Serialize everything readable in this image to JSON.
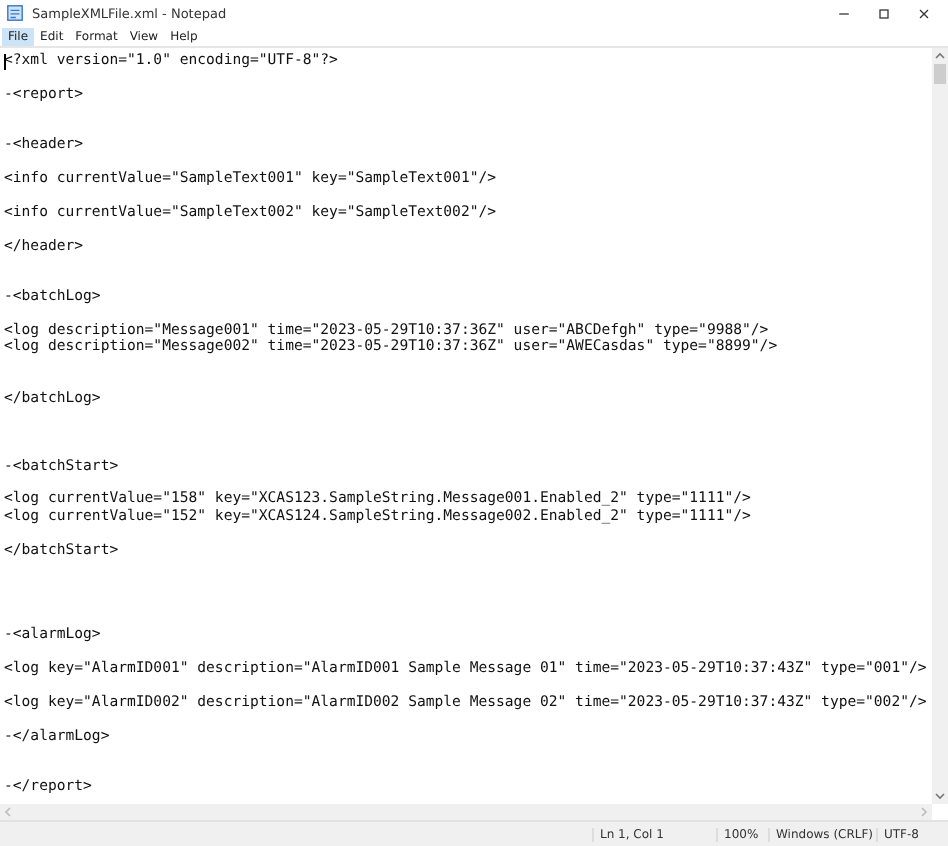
{
  "window": {
    "title": "SampleXMLFile.xml - Notepad"
  },
  "menu": [
    {
      "label": "File",
      "selected": true
    },
    {
      "label": "Edit",
      "selected": false
    },
    {
      "label": "Format",
      "selected": false
    },
    {
      "label": "View",
      "selected": false
    },
    {
      "label": "Help",
      "selected": false
    }
  ],
  "editor": {
    "content": "<?xml version=\"1.0\" encoding=\"UTF-8\"?>\n\n-<report>\n\n\n-<header>\n\n<info currentValue=\"SampleText001\" key=\"SampleText001\"/>\n\n<info currentValue=\"SampleText002\" key=\"SampleText002\"/>\n\n</header>\n\n\n-<batchLog>\n\n<log description=\"Message001\" time=\"2023-05-29T10:37:36Z\" user=\"ABCDefgh\" type=\"9988\"/>\n<log description=\"Message002\" time=\"2023-05-29T10:37:36Z\" user=\"AWECasdas\" type=\"8899\"/>\n\n\n</batchLog>\n\n\n\n-<batchStart>\n\n<log currentValue=\"158\" key=\"XCAS123.SampleString.Message001.Enabled_2\" type=\"1111\"/>\n<log currentValue=\"152\" key=\"XCAS124.SampleString.Message002.Enabled_2\" type=\"1111\"/>\n\n</batchStart>\n\n\n\n\n-<alarmLog>\n\n<log key=\"AlarmID001\" description=\"AlarmID001 Sample Message 01\" time=\"2023-05-29T10:37:43Z\" type=\"001\"/>\n\n<log key=\"AlarmID002\" description=\"AlarmID002 Sample Message 02\" time=\"2023-05-29T10:37:43Z\" type=\"002\"/>\n\n-</alarmLog>\n\n\n-</report>"
  },
  "status_bar": {
    "position": "Ln 1, Col 1",
    "zoom": "100%",
    "line_endings": "Windows (CRLF)",
    "encoding": "UTF-8"
  }
}
